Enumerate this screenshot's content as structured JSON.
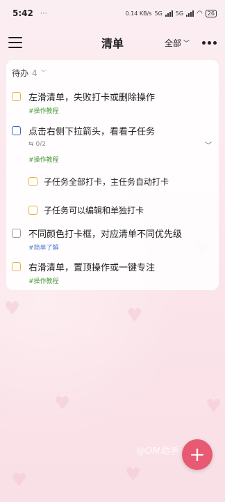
{
  "status_bar": {
    "time": "5:42",
    "dots": "⋯",
    "net_speed": "0.14 KB/s",
    "signal_label_1": "5G",
    "signal_label_2": "5G",
    "battery": "26"
  },
  "header": {
    "title": "清单",
    "filter_label": "全部",
    "menu_icon": "menu-icon",
    "more_icon": "more-icon"
  },
  "section": {
    "label": "待办",
    "count": "4"
  },
  "tasks": [
    {
      "title": "左滑清单，失败打卡或删除操作",
      "tag": "#操作教程",
      "checkbox_color": "#e8b23f"
    },
    {
      "title": "点击右侧下拉箭头，看看子任务",
      "tag": "#操作教程",
      "subtask_progress": "0/2",
      "checkbox_color": "#3d63c9"
    },
    {
      "title": "子任务全部打卡，主任务自动打卡",
      "checkbox_color": "#e8b23f"
    },
    {
      "title": "子任务可以编辑和单独打卡",
      "checkbox_color": "#e8b23f"
    },
    {
      "title": "不同颜色打卡框，对应清单不同优先级",
      "tag": "#简单了解",
      "checkbox_color": "#9a9a9a"
    },
    {
      "title": "右滑清单，置顶操作或一键专注",
      "tag": "#操作教程",
      "checkbox_color": "#e8b23f"
    }
  ],
  "fab": {
    "icon": "plus-icon"
  },
  "watermark": "@OM助手"
}
